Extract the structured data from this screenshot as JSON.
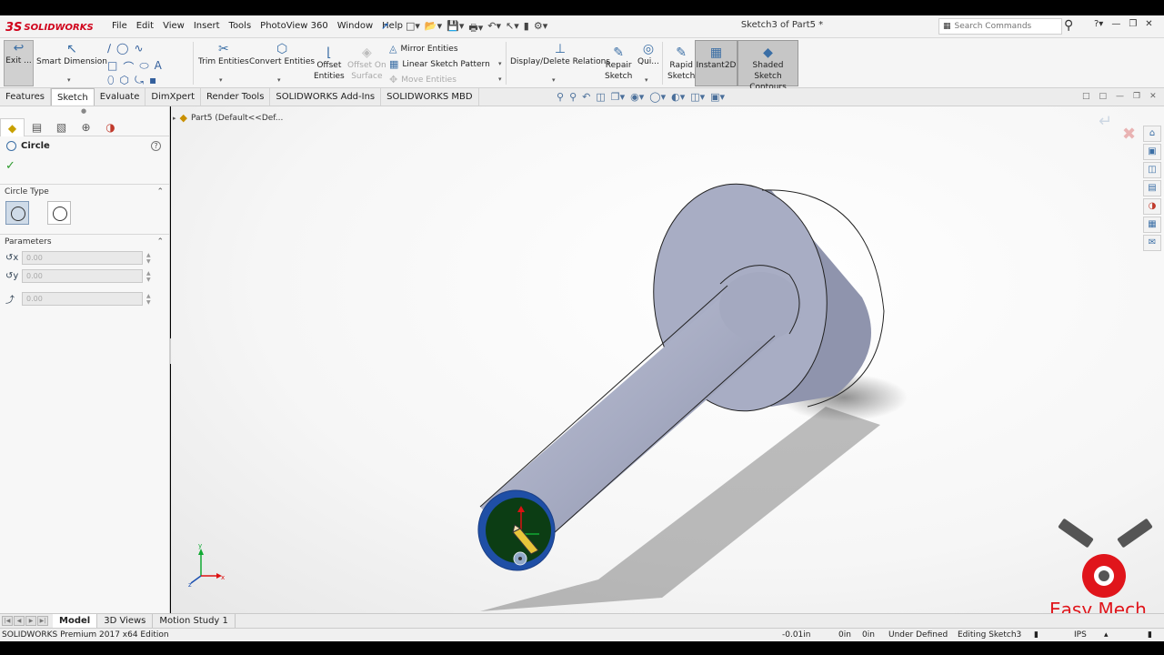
{
  "app": {
    "logo_text": "SOLIDWORKS",
    "document_title": "Sketch3 of Part5 *"
  },
  "menu": [
    "File",
    "Edit",
    "View",
    "Insert",
    "Tools",
    "PhotoView 360",
    "Window",
    "Help"
  ],
  "search": {
    "placeholder": "Search Commands"
  },
  "commands": {
    "exit": "Exit ...",
    "smart_dimension": "Smart Dimension",
    "trim": "Trim Entities",
    "convert": "Convert Entities",
    "offset_line1": "Offset",
    "offset_line2": "Entities",
    "offset_surface_line1": "Offset On",
    "offset_surface_line2": "Surface",
    "mirror": "Mirror Entities",
    "linear_pattern": "Linear Sketch Pattern",
    "move": "Move Entities",
    "display_relations": "Display/Delete Relations",
    "repair_line1": "Repair",
    "repair_line2": "Sketch",
    "quick": "Qui...",
    "rapid_line1": "Rapid",
    "rapid_line2": "Sketch",
    "instant2d": "Instant2D",
    "shaded_line1": "Shaded Sketch",
    "shaded_line2": "Contours"
  },
  "tabs": [
    "Features",
    "Sketch",
    "Evaluate",
    "DimXpert",
    "Render Tools",
    "SOLIDWORKS Add-Ins",
    "SOLIDWORKS MBD"
  ],
  "active_tab": "Sketch",
  "feature_tree": {
    "root": "Part5  (Default<<Def..."
  },
  "property_manager": {
    "title": "Circle",
    "help": "?",
    "circle_type_label": "Circle Type",
    "parameters_label": "Parameters",
    "params": [
      {
        "icon": "cx",
        "value": "0.00"
      },
      {
        "icon": "cy",
        "value": "0.00"
      },
      {
        "icon": "r",
        "value": "0.00"
      }
    ]
  },
  "bottom_tabs": [
    "Model",
    "3D Views",
    "Motion Study 1"
  ],
  "active_bottom_tab": "Model",
  "status": {
    "edition": "SOLIDWORKS Premium 2017 x64 Edition",
    "x": "-0.01in",
    "y": "0in",
    "z": "0in",
    "sketch_state": "Under Defined",
    "editing": "Editing Sketch3",
    "units": "IPS"
  },
  "watermark": {
    "text": "Easy Mech"
  },
  "colors": {
    "accent": "#3a6ea5",
    "part_body": "#a4a9c0",
    "sketch_face": "#0c3d14",
    "sketch_ring": "#1f4fa6",
    "watermark_red": "#e0151b"
  }
}
